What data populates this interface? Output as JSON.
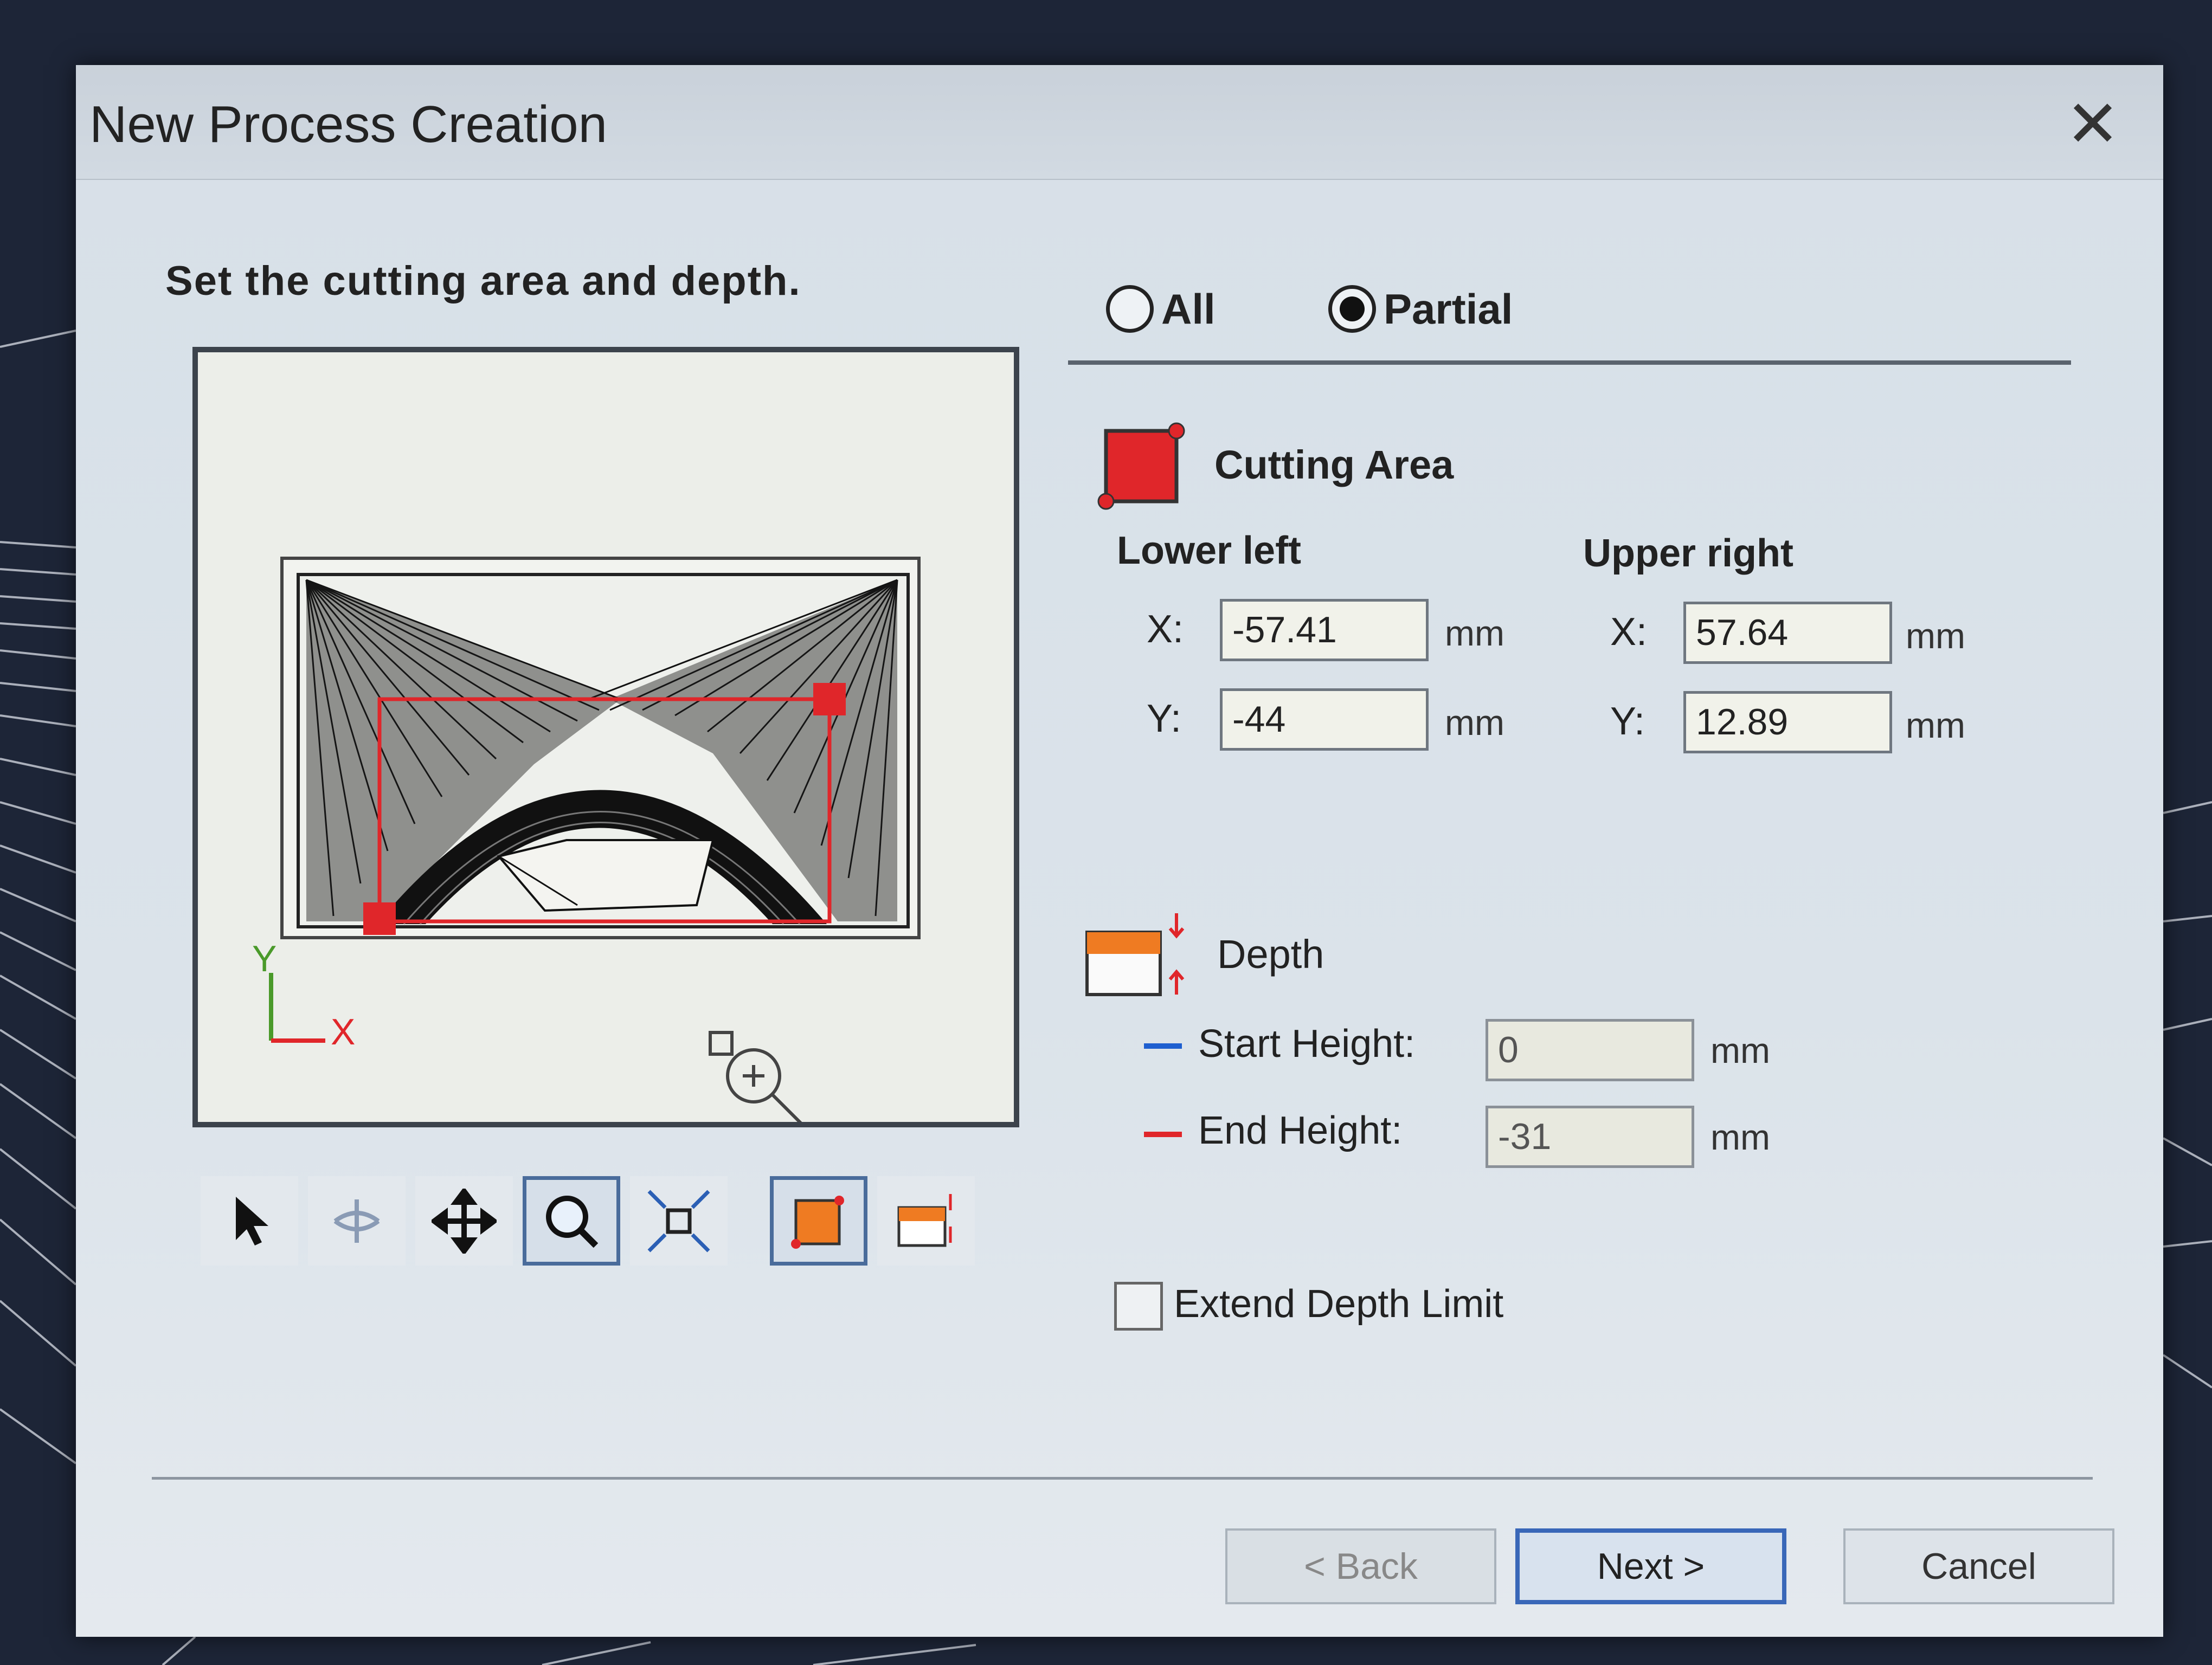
{
  "window": {
    "title": "New Process Creation",
    "close_glyph": "✕"
  },
  "instruction": "Set the cutting area and depth.",
  "mode": {
    "options": [
      {
        "label": "All",
        "selected": false
      },
      {
        "label": "Partial",
        "selected": true
      }
    ]
  },
  "preview": {
    "axis_y": "Y",
    "axis_x": "X"
  },
  "toolbar": {
    "tools": [
      {
        "icon": "pointer-arrow-icon",
        "selected": false
      },
      {
        "icon": "rotate-view-icon",
        "selected": false
      },
      {
        "icon": "pan-move-icon",
        "selected": false
      },
      {
        "icon": "zoom-icon",
        "selected": true
      },
      {
        "icon": "fit-view-icon",
        "selected": false
      },
      {
        "icon": "cutting-area-tool-icon",
        "selected": true
      },
      {
        "icon": "depth-tool-icon",
        "selected": false
      }
    ]
  },
  "cutting_area": {
    "heading": "Cutting Area",
    "lower_left": {
      "label": "Lower left",
      "x_label": "X:",
      "y_label": "Y:",
      "x": "-57.41",
      "y": "-44",
      "unit": "mm"
    },
    "upper_right": {
      "label": "Upper right",
      "x_label": "X:",
      "y_label": "Y:",
      "x": "57.64",
      "y": "12.89",
      "unit": "mm"
    }
  },
  "depth": {
    "heading": "Depth",
    "start_height": {
      "label": "Start Height:",
      "value": "0",
      "unit": "mm",
      "color": "#1e5fd0"
    },
    "end_height": {
      "label": "End Height:",
      "value": "-31",
      "unit": "mm",
      "color": "#e0262a"
    }
  },
  "extend_depth_limit": {
    "label": "Extend Depth Limit",
    "checked": false
  },
  "buttons": {
    "back": "< Back",
    "next": "Next >",
    "cancel": "Cancel"
  },
  "colors": {
    "accent": "#3967b8",
    "cutting_red": "#e0262a",
    "orange": "#ef7b22"
  }
}
